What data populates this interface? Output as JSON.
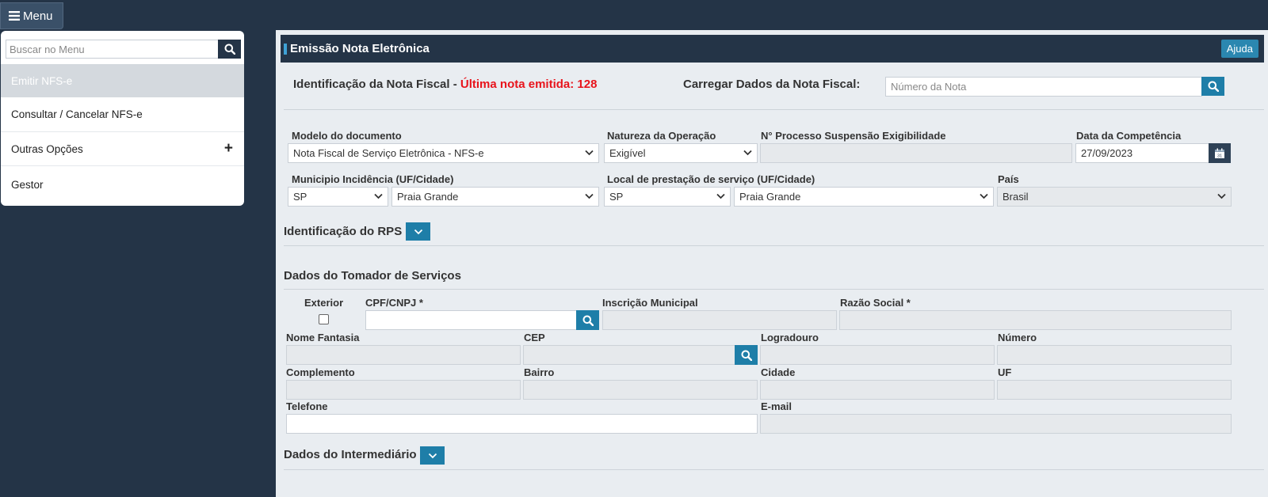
{
  "menu_button": {
    "label": "Menu"
  },
  "sidebar": {
    "search_placeholder": "Buscar no Menu",
    "items": [
      {
        "label": "Emitir NFS-e",
        "active": true
      },
      {
        "label": "Consultar / Cancelar NFS-e"
      },
      {
        "label": "Outras Opções",
        "expander": "+"
      },
      {
        "label": "Gestor"
      }
    ]
  },
  "main": {
    "title": "Emissão Nota Eletrônica",
    "help_label": "Ajuda",
    "identification": {
      "prefix": "Identificação da Nota Fiscal - ",
      "last_note": "Última nota emitida: 128",
      "load_label": "Carregar Dados da Nota Fiscal:",
      "note_number_placeholder": "Número da Nota"
    },
    "document": {
      "modelo_label": "Modelo do documento",
      "modelo_value": "Nota Fiscal de Serviço Eletrônica - NFS-e",
      "natureza_label": "Natureza da Operação",
      "natureza_value": "Exigível",
      "processo_label": "N° Processo Suspensão Exigibilidade",
      "processo_value": "",
      "competencia_label": "Data da Competência",
      "competencia_value": "27/09/2023",
      "incidencia_label": "Municipio Incidência (UF/Cidade)",
      "incidencia_uf": "SP",
      "incidencia_cidade": "Praia Grande",
      "local_label": "Local de prestação de serviço (UF/Cidade)",
      "local_uf": "SP",
      "local_cidade": "Praia Grande",
      "pais_label": "País",
      "pais_value": "Brasil"
    },
    "rps": {
      "title": "Identificação do RPS"
    },
    "tomador": {
      "title": "Dados do Tomador de Serviços",
      "exterior_label": "Exterior",
      "cpf_label": "CPF/CNPJ *",
      "cpf_value": "",
      "inscricao_label": "Inscrição Municipal",
      "razao_label": "Razão Social *",
      "nome_fantasia_label": "Nome Fantasia",
      "cep_label": "CEP",
      "logradouro_label": "Logradouro",
      "numero_label": "Número",
      "complemento_label": "Complemento",
      "bairro_label": "Bairro",
      "cidade_label": "Cidade",
      "uf_label": "UF",
      "telefone_label": "Telefone",
      "telefone_value": "",
      "email_label": "E-mail"
    },
    "intermediario": {
      "title": "Dados do Intermediário"
    }
  },
  "colors": {
    "background": "#243447",
    "panel": "#e9edf1",
    "accent_blue": "#1e7ea8",
    "alert_red": "#e8141c"
  },
  "icons": [
    "hamburger-icon",
    "search-icon",
    "calendar-icon",
    "chevron-down-icon",
    "plus-icon"
  ]
}
